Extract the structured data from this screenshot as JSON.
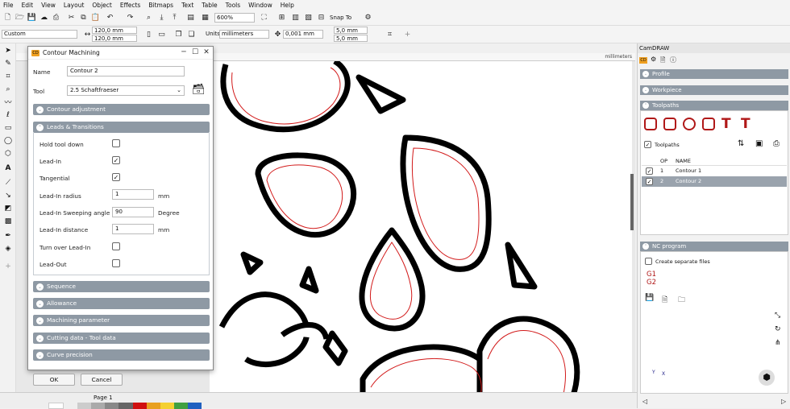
{
  "menu": [
    "File",
    "Edit",
    "View",
    "Layout",
    "Object",
    "Effects",
    "Bitmaps",
    "Text",
    "Table",
    "Tools",
    "Window",
    "Help"
  ],
  "toolbar": {
    "zoom": "600%",
    "snap": "Snap To"
  },
  "propbar": {
    "preset": "Custom",
    "width": "120,0 mm",
    "height": "120,0 mm",
    "units_label": "Units:",
    "units": "millimeters",
    "nudge": "0,001 mm",
    "dup_x": "5,0 mm",
    "dup_y": "5,0 mm"
  },
  "ruler": {
    "unit": "millimeters"
  },
  "status": {
    "page": "Page 1"
  },
  "dialog": {
    "title": "Contour Machining",
    "name_label": "Name",
    "name_value": "Contour 2",
    "tool_label": "Tool",
    "tool_value": "2.5 Schaftfraeser",
    "sections_top": [
      "Contour adjustment",
      "Leads & Transitions"
    ],
    "fields": {
      "hold_tool_down": "Hold tool down",
      "lead_in": "Lead-In",
      "tangential": "Tangential",
      "lead_in_radius": "Lead-In radius",
      "lead_in_radius_value": "1",
      "lead_in_radius_unit": "mm",
      "sweep": "Lead-In Sweeping angle",
      "sweep_value": "90",
      "sweep_unit": "Degree",
      "distance": "Lead-In distance",
      "distance_value": "1",
      "distance_unit": "mm",
      "turn_over": "Turn over Lead-In",
      "lead_out": "Lead-Out"
    },
    "sections_bottom": [
      "Sequence",
      "Allowance",
      "Machining parameter",
      "Cutting data - Tool data",
      "Curve precision"
    ],
    "ok": "OK",
    "cancel": "Cancel"
  },
  "panel": {
    "title": "CamDRAW",
    "profile": "Profile",
    "workpiece": "Workpiece",
    "toolpaths": "Toolpaths",
    "toolpaths_check": "Toolpaths",
    "table_headers": [
      "OP",
      "NAME"
    ],
    "rows": [
      {
        "op": "1",
        "name": "Contour 1"
      },
      {
        "op": "2",
        "name": "Contour 2"
      }
    ],
    "nc_program": "NC program",
    "separate_files": "Create separate files",
    "g1": "G1",
    "g2": "G2",
    "axis_y": "Y",
    "axis_x": "X"
  },
  "colors": {
    "accent": "#8e99a4",
    "red": "#b01818",
    "selected_row": "#9aa3ad"
  }
}
